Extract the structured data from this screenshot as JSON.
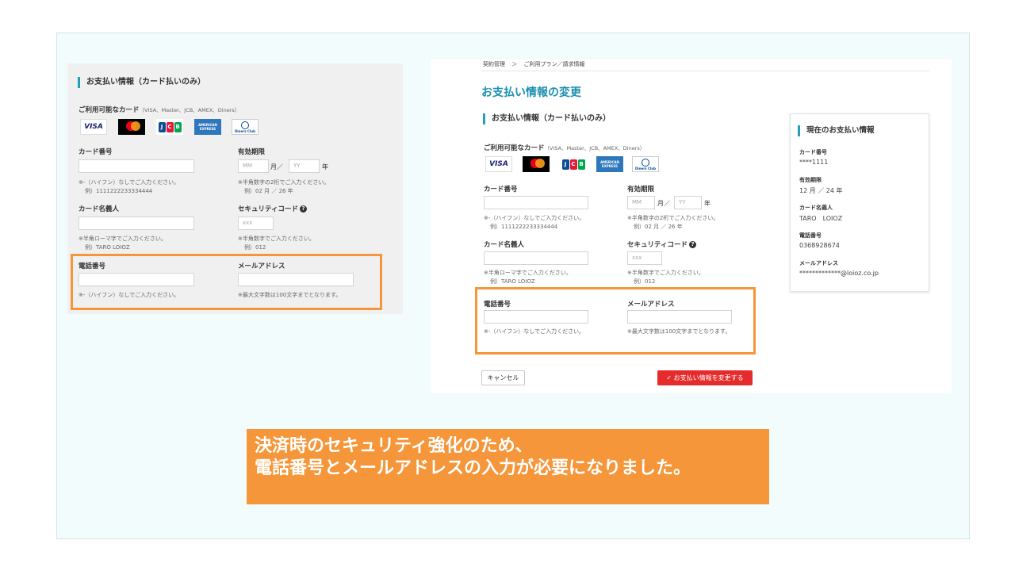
{
  "left_form": {
    "section_title": "お支払い情報（カード払いのみ）",
    "available_cards_label": "ご利用可能なカード",
    "available_cards_sub": "（VISA、Master、JCB、AMEX、Diners）",
    "card_number_label": "カード番号",
    "card_number_note1": "※-（ハイフン）なしでご入力ください。",
    "card_number_note2": "例）1111222233334444",
    "expiry_label": "有効期限",
    "expiry_mm_placeholder": "MM",
    "expiry_month_unit": "月／",
    "expiry_yy_placeholder": "YY",
    "expiry_year_unit": "年",
    "expiry_note1": "※半角数字の2桁でご入力ください。",
    "expiry_note2": "例）02 月 ／ 26 年",
    "holder_label": "カード名義人",
    "holder_note1": "※半角ローマ字でご入力ください。",
    "holder_note2": "例）TARO LOIOZ",
    "cvc_label": "セキュリティコード",
    "cvc_placeholder": "xxx",
    "cvc_note1": "※半角数字でご入力ください。",
    "cvc_note2": "例）012",
    "phone_label": "電話番号",
    "phone_note": "※-（ハイフン）なしでご入力ください。",
    "email_label": "メールアドレス",
    "email_note": "※最大文字数は100文字までとなります。"
  },
  "right_form": {
    "breadcrumb_root": "契約管理",
    "breadcrumb_sep": "＞",
    "breadcrumb_current": "ご利用プラン／請求情報",
    "page_title": "お支払い情報の変更",
    "section_title": "お支払い情報（カード払いのみ）",
    "available_cards_label": "ご利用可能なカード",
    "available_cards_sub": "（VISA、Master、JCB、AMEX、Diners）",
    "card_number_label": "カード番号",
    "card_number_note1": "※-（ハイフン）なしでご入力ください。",
    "card_number_note2": "例）1111222233334444",
    "expiry_label": "有効期限",
    "expiry_mm_placeholder": "MM",
    "expiry_month_unit": "月／",
    "expiry_yy_placeholder": "YY",
    "expiry_year_unit": "年",
    "expiry_note1": "※半角数字の2桁でご入力ください。",
    "expiry_note2": "例）02 月 ／ 26 年",
    "holder_label": "カード名義人",
    "holder_note1": "※半角ローマ字でご入力ください。",
    "holder_note2": "例）TARO LOIOZ",
    "cvc_label": "セキュリティコード",
    "cvc_placeholder": "xxx",
    "cvc_note1": "※半角数字でご入力ください。",
    "cvc_note2": "例）012",
    "phone_label": "電話番号",
    "phone_note": "※-（ハイフン）なしでご入力ください。",
    "email_label": "メールアドレス",
    "email_note": "※最大文字数は100文字までとなります。",
    "cancel_button": "キャンセル",
    "submit_button": "お支払い情報を変更する"
  },
  "current_info": {
    "title": "現在のお支払い情報",
    "card_number_label": "カード番号",
    "card_number_value": "****1111",
    "expiry_label": "有効期限",
    "expiry_value": "12 月 ／ 24 年",
    "holder_label": "カード名義人",
    "holder_value": "TARO　LOIOZ",
    "phone_label": "電話番号",
    "phone_value": "0368928674",
    "email_label": "メールアドレス",
    "email_value": "*************@loioz.co.jp"
  },
  "cards": {
    "visa": "VISA",
    "jcb": [
      "J",
      "C",
      "B"
    ],
    "amex": "AMERICAN EXPRESS",
    "diners": "Diners Club"
  },
  "banner": {
    "line1": "決済時のセキュリティ強化のため、",
    "line2": "電話番号とメールアドレスの入力が必要になりました。"
  },
  "colors": {
    "accent_teal": "#21a0b8",
    "highlight_orange": "#f5963a",
    "submit_red": "#e52b2b"
  },
  "icons": {
    "help": "?",
    "check": "✓"
  }
}
